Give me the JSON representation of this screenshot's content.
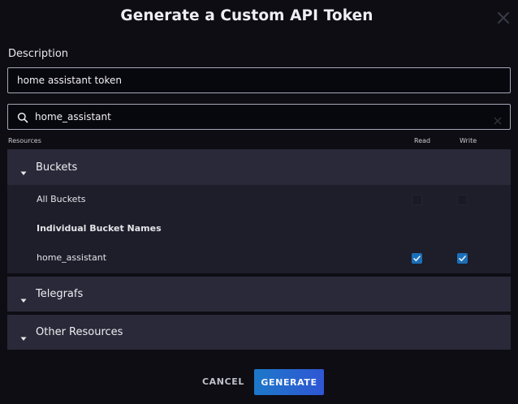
{
  "modal": {
    "title": "Generate a Custom API Token",
    "close_icon": "close-icon"
  },
  "description": {
    "label": "Description",
    "value": "home assistant token"
  },
  "search": {
    "value": "home_assistant",
    "icon": "search-icon",
    "clear_icon": "clear-icon"
  },
  "columns": {
    "resources": "Resources",
    "read": "Read",
    "write": "Write"
  },
  "sections": {
    "buckets": {
      "title": "Buckets",
      "expanded": true,
      "all_label": "All Buckets",
      "all_read": false,
      "all_write": false,
      "individual_heading": "Individual Bucket Names",
      "items": [
        {
          "name": "home_assistant",
          "read": true,
          "write": true
        }
      ]
    },
    "telegrafs": {
      "title": "Telegrafs",
      "expanded": false
    },
    "other": {
      "title": "Other Resources",
      "expanded": false
    }
  },
  "footer": {
    "cancel_label": "CANCEL",
    "generate_label": "GENERATE"
  },
  "colors": {
    "background": "#0e0d14",
    "section_header": "#2a2939",
    "section_body": "#1e1d2a",
    "checkbox_checked": "#1b6fb8",
    "primary_button_start": "#1d78c9",
    "primary_button_end": "#2f56d4"
  }
}
